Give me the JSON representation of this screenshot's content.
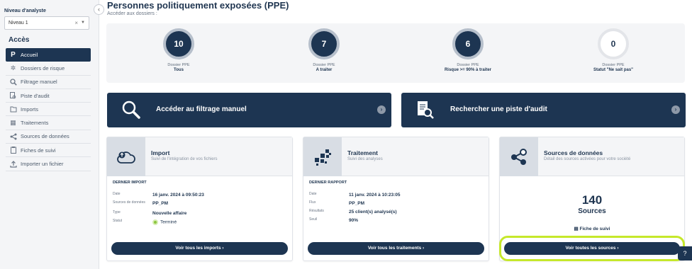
{
  "sidebar": {
    "niveau_label": "Niveau d'analyste",
    "niveau_value": "Niveau 1",
    "acces_title": "Accès",
    "items": [
      {
        "label": "Accueil",
        "icon": "logo-p-icon"
      },
      {
        "label": "Dossiers de risque",
        "icon": "dossiers-icon"
      },
      {
        "label": "Filtrage manuel",
        "icon": "search-icon"
      },
      {
        "label": "Piste d'audit",
        "icon": "audit-icon"
      },
      {
        "label": "Imports",
        "icon": "import-icon"
      },
      {
        "label": "Traitements",
        "icon": "traitement-icon"
      },
      {
        "label": "Sources de données",
        "icon": "share-icon"
      },
      {
        "label": "Fiches de suivi",
        "icon": "clipboard-icon"
      },
      {
        "label": "Importer un fichier",
        "icon": "upload-icon"
      }
    ]
  },
  "header": {
    "title": "Personnes politiquement exposées (PPE)",
    "subtitle": "Accéder aux dossiers :"
  },
  "stats": [
    {
      "value": "10",
      "label1": "Dossier PPE",
      "label2": "Tous"
    },
    {
      "value": "7",
      "label1": "Dossier PPE",
      "label2": "A traiter"
    },
    {
      "value": "6",
      "label1": "Dossier PPE",
      "label2": "Risque >= 90% à traiter"
    },
    {
      "value": "0",
      "label1": "Dossier PPE",
      "label2": "Statut \"Ne sait pas\""
    }
  ],
  "banners": {
    "filtrage": "Accéder au filtrage manuel",
    "audit": "Rechercher une piste d'audit"
  },
  "cards": {
    "import": {
      "title": "Import",
      "desc": "Suivi de l'intégration de vos fichiers",
      "section": "DERNIER IMPORT",
      "rows": [
        {
          "k": "Date",
          "v": "16 janv. 2024 à 09:50:23"
        },
        {
          "k": "Sources de données",
          "v": "PP_PM"
        },
        {
          "k": "Type",
          "v": "Nouvelle affaire"
        },
        {
          "k": "Statut",
          "v": "Terminé"
        }
      ],
      "button": "Voir tous les imports ›"
    },
    "traitement": {
      "title": "Traitement",
      "desc": "Suivi des analyses",
      "section": "DERNIER RAPPORT",
      "rows": [
        {
          "k": "Date",
          "v": "11 janv. 2024 à 10:23:05"
        },
        {
          "k": "Flux",
          "v": "PP_PM"
        },
        {
          "k": "Résultats",
          "v": "25 client(s) analysé(s)"
        },
        {
          "k": "Seuil",
          "v": "90%"
        }
      ],
      "button": "Voir tous les traitements ›"
    },
    "sources": {
      "title": "Sources de données",
      "desc": "Détail des sources activées pour votre société",
      "count": "140",
      "count_label": "Sources",
      "fiche": "Fiche de suivi",
      "button": "Voir toutes les sources ›"
    }
  },
  "colors": {
    "navy": "#1d3552",
    "highlight": "#c6e82b",
    "success": "#8dc63f"
  }
}
